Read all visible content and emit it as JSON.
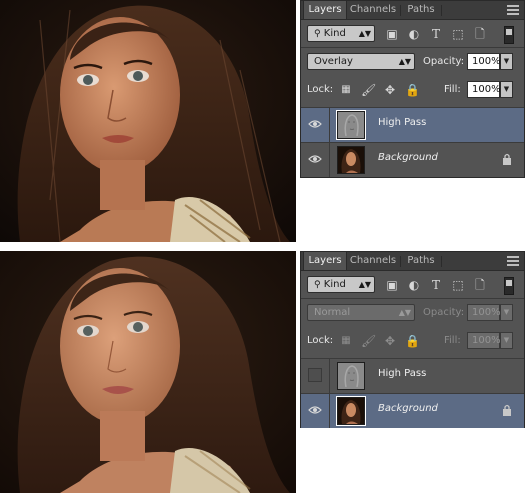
{
  "top": {
    "tabs": [
      "Layers",
      "Channels",
      "Paths"
    ],
    "filter": {
      "kind_label": "Kind"
    },
    "blend_mode": "Overlay",
    "opacity_label": "Opacity:",
    "opacity_value": "100%",
    "lock_label": "Lock:",
    "fill_label": "Fill:",
    "fill_value": "100%",
    "layers": [
      {
        "name": "High Pass",
        "visible": true,
        "selected": true,
        "italic": false,
        "locked": false,
        "thumb": "high-pass"
      },
      {
        "name": "Background",
        "visible": true,
        "selected": false,
        "italic": true,
        "locked": true,
        "thumb": "portrait"
      }
    ]
  },
  "bottom": {
    "tabs": [
      "Layers",
      "Channels",
      "Paths"
    ],
    "filter": {
      "kind_label": "Kind"
    },
    "blend_mode": "Normal",
    "opacity_label": "Opacity:",
    "opacity_value": "100%",
    "lock_label": "Lock:",
    "fill_label": "Fill:",
    "fill_value": "100%",
    "layers": [
      {
        "name": "High Pass",
        "visible": false,
        "selected": false,
        "italic": false,
        "locked": false,
        "thumb": "high-pass"
      },
      {
        "name": "Background",
        "visible": true,
        "selected": true,
        "italic": true,
        "locked": true,
        "thumb": "portrait"
      }
    ]
  },
  "icons": {
    "search": "search-icon",
    "filters": [
      "image-filter-icon",
      "adjustment-filter-icon",
      "type-filter-icon",
      "shape-filter-icon",
      "smart-object-filter-icon"
    ],
    "locks": [
      "lock-transparent-icon",
      "lock-paint-icon",
      "lock-position-icon",
      "lock-all-icon"
    ]
  },
  "colors": {
    "panel_bg": "#535353",
    "tab_bar": "#3c3c3c",
    "selection": "#5c6b85"
  }
}
